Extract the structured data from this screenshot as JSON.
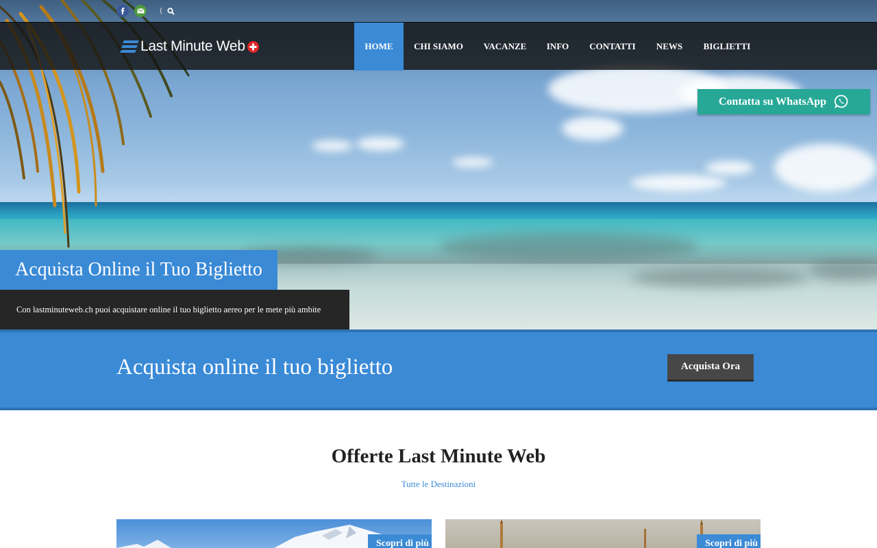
{
  "brand": {
    "name": "Last Minute Web"
  },
  "topbar": {
    "social": [
      {
        "network": "facebook",
        "icon": "facebook-icon",
        "color": "#3b5998"
      },
      {
        "network": "email",
        "icon": "mail-icon",
        "color": "#4c9a3f"
      }
    ],
    "separator": "(",
    "search_icon": "search-icon"
  },
  "nav": {
    "items": [
      {
        "label": "HOME",
        "active": true
      },
      {
        "label": "CHI SIAMO",
        "active": false
      },
      {
        "label": "VACANZE",
        "active": false
      },
      {
        "label": "INFO",
        "active": false
      },
      {
        "label": "CONTATTI",
        "active": false
      },
      {
        "label": "NEWS",
        "active": false
      },
      {
        "label": "BIGLIETTI",
        "active": false
      }
    ]
  },
  "whatsapp": {
    "label": "Contatta su WhatsApp",
    "icon": "whatsapp-icon",
    "color": "#27a897"
  },
  "slider": {
    "title": "Acquista Online il Tuo Biglietto",
    "subtitle": "Con lastminuteweb.ch puoi acquistare online il tuo biglietto aereo per le mete più ambite"
  },
  "cta": {
    "text": "Acquista online il tuo biglietto",
    "button": "Acquista Ora"
  },
  "offers": {
    "title": "Offerte Last Minute Web",
    "link": "Tutte le Destinazioni",
    "cards": [
      {
        "button": "Scopri di più"
      },
      {
        "button": "Scopri di più"
      }
    ]
  },
  "colors": {
    "accent": "#3a8ad6",
    "dark": "#262626",
    "whatsapp": "#27a897"
  }
}
